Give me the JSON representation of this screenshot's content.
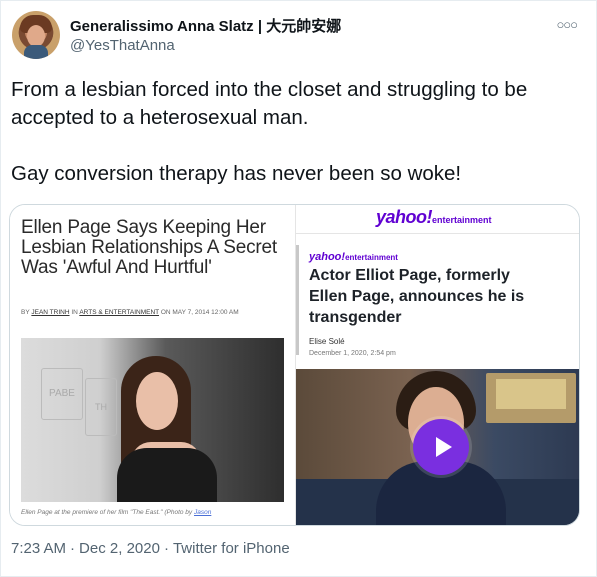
{
  "author": {
    "display_name": "Generalissimo Anna Slatz | 大元帥安娜",
    "handle": "@YesThatAnna"
  },
  "more_menu_icon": "more-icon",
  "tweet": {
    "paragraphs": [
      "From a lesbian forced into the closet and struggling to be accepted to a heterosexual man.",
      "Gay conversion therapy has never been so woke!"
    ]
  },
  "media": {
    "left": {
      "headline": "Ellen Page Says Keeping Her Lesbian Relationships A Secret Was 'Awful And Hurtful'",
      "byline": {
        "by": "BY",
        "author": "JEAN TRINH",
        "in": "IN",
        "section": "ARTS & ENTERTAINMENT",
        "on": "ON MAY 7, 2014 12:00 AM"
      },
      "photo_text_1": "PABE",
      "photo_text_2": "TH",
      "caption": "Ellen Page at the premiere of her film \"The East.\" (Photo by",
      "caption_link": "Jason"
    },
    "right": {
      "brand_top": {
        "logo": "yahoo!",
        "section": "entertainment"
      },
      "brand_small": {
        "logo": "yahoo!",
        "section": "entertainment"
      },
      "headline": "Actor Elliot Page, formerly Ellen Page, announces he is transgender",
      "author": "Elise Solé",
      "date": "December 1, 2020, 2:54 pm",
      "play_icon": "play-icon"
    }
  },
  "meta": {
    "time": "7:23 AM",
    "date": "Dec 2, 2020",
    "source": "Twitter for iPhone",
    "separator": "·"
  },
  "colors": {
    "yahoo_purple": "#6001d2",
    "play_button": "#7a2fe0",
    "meta_gray": "#536471"
  }
}
